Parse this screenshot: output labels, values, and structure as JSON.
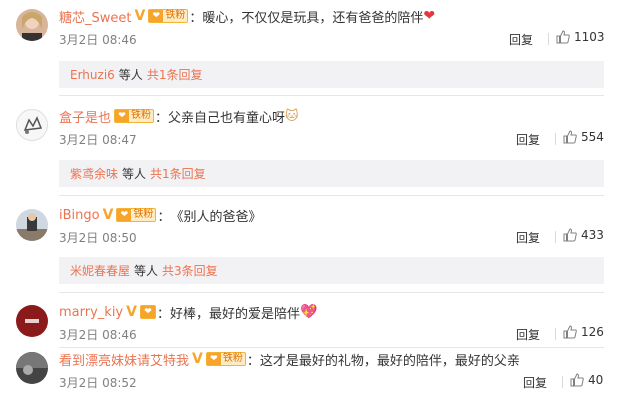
{
  "comments": [
    {
      "username": "糖芯_Sweet",
      "has_v": true,
      "text": "暖心，不仅仅是玩具，还有爸爸的陪伴",
      "emoji": "heart-emoji",
      "time": "3月2日 08:46",
      "reply_label": "回复",
      "likes": "1103",
      "sub_user": "Erhuzi6",
      "sub_deng": "等人",
      "sub_more": "共1条回复"
    },
    {
      "username": "盒子是也",
      "has_v": false,
      "text": "父亲自己也有童心呀",
      "emoji": "cat-emoji",
      "time": "3月2日 08:47",
      "reply_label": "回复",
      "likes": "554",
      "sub_user": "紫鸢余味",
      "sub_deng": "等人",
      "sub_more": "共1条回复"
    },
    {
      "username": "iBingo",
      "has_v": true,
      "text": "《别人的爸爸》",
      "time": "3月2日 08:50",
      "reply_label": "回复",
      "likes": "433",
      "sub_user": "米妮春春屋",
      "sub_deng": "等人",
      "sub_more": "共3条回复"
    },
    {
      "username": "marry_kiy",
      "has_v": true,
      "text": "好棒，最好的爱是陪伴",
      "emoji": "sparkle-heart-emoji",
      "time": "3月2日 08:46",
      "reply_label": "回复",
      "likes": "126"
    },
    {
      "username": "看到漂亮妹妹请艾特我",
      "has_v": true,
      "text": "这才是最好的礼物，最好的陪伴，最好的父亲",
      "time": "3月2日 08:52",
      "reply_label": "回复",
      "likes": "40"
    }
  ],
  "badge_text": "铁粉",
  "colors": {
    "username": "#eb7350",
    "vip_v": "#f7a52a",
    "sub_bg": "#f2f2f5",
    "time": "#808080"
  }
}
